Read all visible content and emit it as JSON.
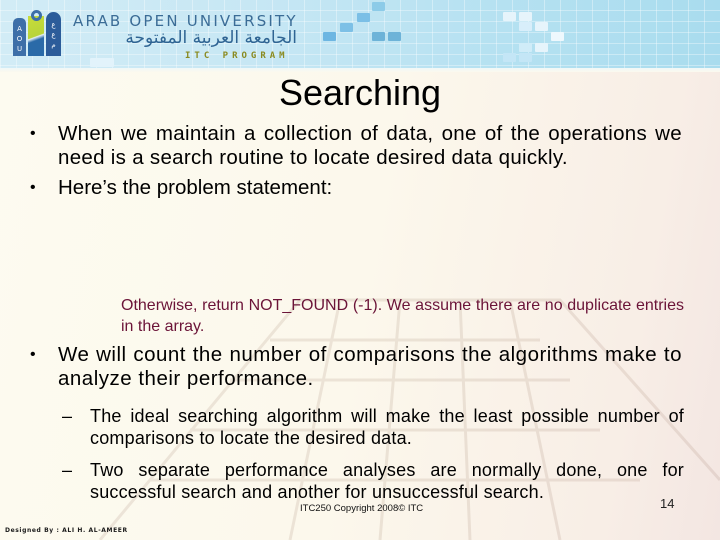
{
  "header": {
    "university_en": "ARAB OPEN UNIVERSITY",
    "university_ar": "الجامعة العربية المفتوحة",
    "program": "ITC PROGRAM",
    "logo_left_text": "A O U",
    "logo_right_text": "ع ع م",
    "logo_icon": "aou-logo-icon"
  },
  "slide": {
    "title": "Searching",
    "bullets": [
      {
        "marker": "•",
        "text": "When we maintain a collection of data, one of the operations we need is a search routine to locate desired data quickly."
      },
      {
        "marker": "•",
        "text": "Here’s the problem statement:"
      }
    ],
    "problem_statement": "Otherwise, return NOT_FOUND (-1). We assume there are no duplicate entries in the array.",
    "bullets_2": [
      {
        "marker": "•",
        "text": "We will count the number of comparisons the algorithms make to analyze their performance."
      }
    ],
    "sub_bullets": [
      {
        "marker": "–",
        "text": "The ideal searching algorithm will make the least possible number of comparisons to locate the desired data."
      },
      {
        "marker": "–",
        "text": "Two separate performance analyses are normally done, one for successful search and another for unsuccessful search."
      }
    ]
  },
  "footer": {
    "copyright": "ITC250 Copyright 2008© ITC",
    "page_number": "14",
    "designer": "Designed By : ALI H. AL-AMEER"
  },
  "colors": {
    "banner": "#c7e7f4",
    "statement_text": "#6b1438",
    "program_text": "#8a8a20",
    "university_text": "#3b6c96"
  }
}
